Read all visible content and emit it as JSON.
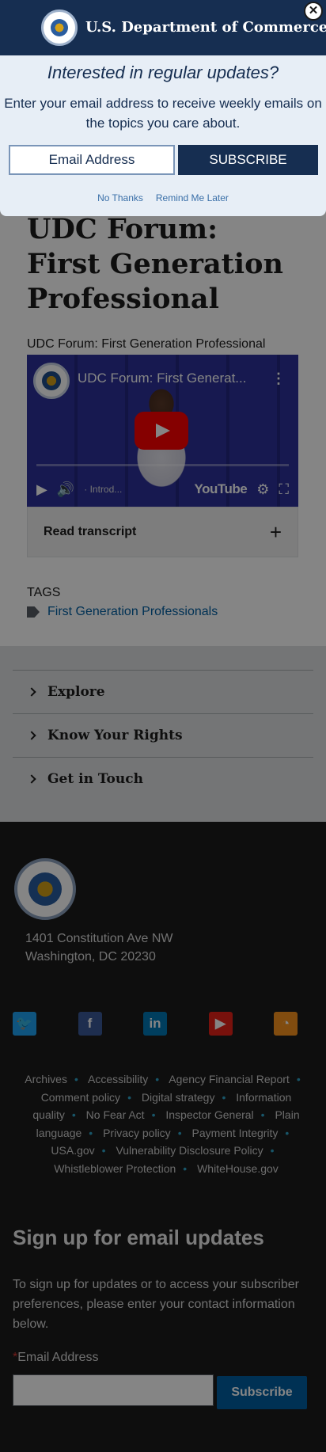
{
  "modal": {
    "agency_title": "U.S. Department of Commerce",
    "close_glyph": "✕",
    "heading": "Interested in regular updates?",
    "description": "Enter your email address to receive weekly emails on the topics you care about.",
    "email_placeholder": "Email Address",
    "subscribe_label": "SUBSCRIBE",
    "no_thanks_label": "No Thanks",
    "remind_later_label": "Remind Me Later"
  },
  "article": {
    "title": "UDC Forum: First Generation Professional",
    "video_caption": "UDC Forum: First Generation Professional"
  },
  "video": {
    "title": "UDC Forum: First Generat...",
    "menu_glyph": "⋮",
    "chapter": "· Introd...",
    "brand": "YouTube"
  },
  "transcript": {
    "label": "Read transcript",
    "toggle": "+"
  },
  "tags": {
    "label": "TAGS",
    "items": [
      "First Generation Professionals"
    ]
  },
  "accordion": {
    "items": [
      {
        "label": "Explore"
      },
      {
        "label": "Know Your Rights"
      },
      {
        "label": "Get in Touch"
      }
    ]
  },
  "footer": {
    "address_line1": "1401 Constitution Ave NW",
    "address_line2": "Washington, DC 20230",
    "social": [
      "twitter-icon",
      "facebook-icon",
      "linkedin-icon",
      "youtube-icon",
      "rss-icon"
    ],
    "links": [
      "Archives",
      "Accessibility",
      "Agency Financial Report",
      "Comment policy",
      "Digital strategy",
      "Information quality",
      "No Fear Act",
      "Inspector General",
      "Plain language",
      "Privacy policy",
      "Payment Integrity",
      "USA.gov",
      "Vulnerability Disclosure Policy",
      "Whistleblower Protection",
      "WhiteHouse.gov"
    ],
    "signup_title": "Sign up for email updates",
    "signup_desc": "To sign up for updates or to access your subscriber preferences, please enter your contact information below.",
    "email_label": "Email Address",
    "required_marker": "*",
    "subscribe_label": "Subscribe"
  },
  "colors": {
    "navy": "#162e51",
    "link_blue": "#005ea2",
    "footer_bg": "#1b1b1b",
    "modal_bg": "#e7eef6"
  }
}
